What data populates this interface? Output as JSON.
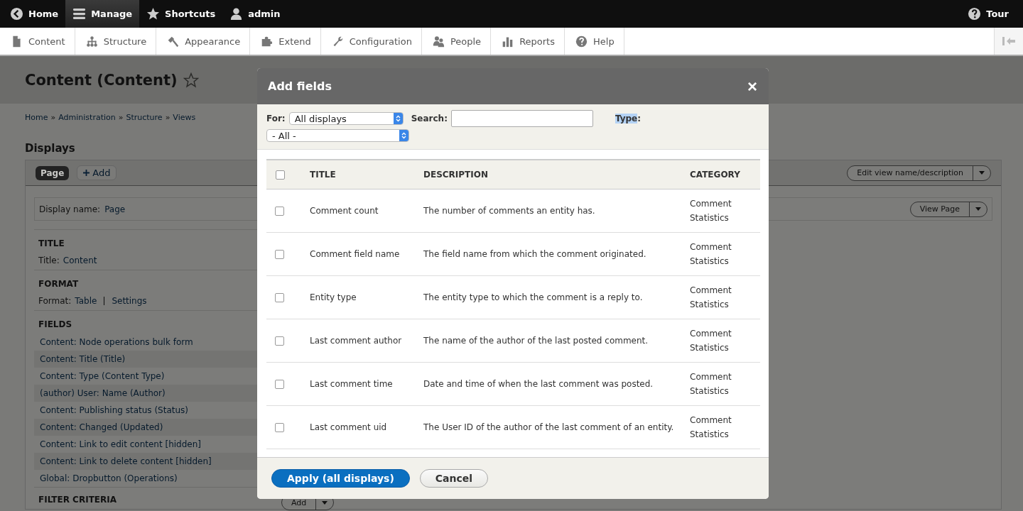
{
  "toolbar": {
    "items": [
      {
        "label": "Home",
        "selected": false
      },
      {
        "label": "Manage",
        "selected": true
      },
      {
        "label": "Shortcuts",
        "selected": false
      },
      {
        "label": "admin",
        "selected": false
      }
    ],
    "tour": {
      "label": "Tour"
    }
  },
  "tray": {
    "items": [
      {
        "label": "Content"
      },
      {
        "label": "Structure"
      },
      {
        "label": "Appearance"
      },
      {
        "label": "Extend"
      },
      {
        "label": "Configuration"
      },
      {
        "label": "People"
      },
      {
        "label": "Reports"
      },
      {
        "label": "Help"
      }
    ]
  },
  "page": {
    "title": "Content (Content)",
    "breadcrumb": [
      {
        "label": "Home"
      },
      {
        "separator": "»",
        "label": "Administration"
      },
      {
        "separator": "»",
        "label": "Structure"
      },
      {
        "separator": "»",
        "label": "Views"
      }
    ],
    "displays_heading": "Displays",
    "display_tabs": [
      {
        "label": "Page",
        "selected": true
      }
    ],
    "add_display": "Add",
    "edit_view_button": "Edit view name/description",
    "display_name_label": "Display name:",
    "display_name": "Page",
    "view_page_button": "View Page",
    "title_heading": "TITLE",
    "title_label": "Title:",
    "title_value": "Content",
    "format_heading": "FORMAT",
    "format_label": "Format:",
    "format_value": "Table",
    "format_settings": "Settings",
    "fields_heading": "FIELDS",
    "fields": [
      "Content: Node operations bulk form",
      "Content: Title (Title)",
      "Content: Type (Content Type)",
      "(author) User: Name (Author)",
      "Content: Publishing status (Status)",
      "Content: Changed (Updated)",
      "Content: Link to edit content [hidden]",
      "Content: Link to delete content [hidden]",
      "Global: Dropbutton (Operations)"
    ],
    "filter_heading": "FILTER CRITERIA",
    "filter_add": "Add"
  },
  "modal": {
    "title": "Add fields",
    "close": "×",
    "for_label": "For:",
    "for_value": "All displays",
    "search_label": "Search:",
    "type_label": "Type",
    "type_colon": ":",
    "type_highlighted": true,
    "type_value": "- All -",
    "columns": [
      "TITLE",
      "DESCRIPTION",
      "CATEGORY"
    ],
    "select_all_checked": false,
    "rows": [
      {
        "title": "Comment count",
        "description": "The number of comments an entity has.",
        "category": "Comment Statistics",
        "checked": false
      },
      {
        "title": "Comment field name",
        "description": "The field name from which the comment originated.",
        "category": "Comment Statistics",
        "checked": false
      },
      {
        "title": "Entity type",
        "description": "The entity type to which the comment is a reply to.",
        "category": "Comment Statistics",
        "checked": false
      },
      {
        "title": "Last comment author",
        "description": "The name of the author of the last posted comment.",
        "category": "Comment Statistics",
        "checked": false
      },
      {
        "title": "Last comment time",
        "description": "Date and time of when the last comment was posted.",
        "category": "Comment Statistics",
        "checked": false
      },
      {
        "title": "Last comment uid",
        "description": "The User ID of the author of the last comment of an entity.",
        "category": "Comment Statistics",
        "checked": false
      }
    ],
    "apply": "Apply (all displays)",
    "cancel": "Cancel"
  }
}
